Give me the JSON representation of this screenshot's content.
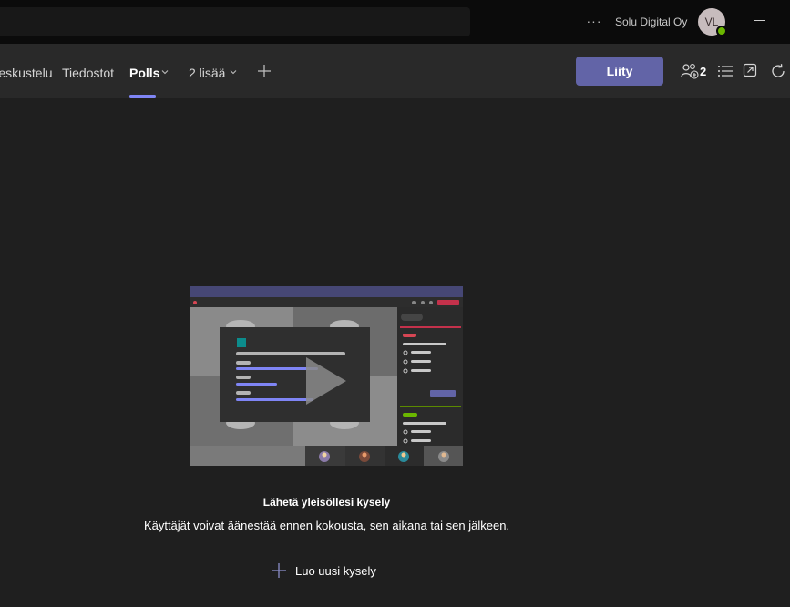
{
  "titlebar": {
    "org_name": "Solu Digital Oy",
    "more_glyph": "···",
    "avatar_initials": "VL",
    "presence_color": "#6bb700"
  },
  "tabs": [
    {
      "label": "Keskustelu",
      "active": false
    },
    {
      "label": "Tiedostot",
      "active": false
    },
    {
      "label": "Polls",
      "active": true
    },
    {
      "label": "2 lisää",
      "active": false
    }
  ],
  "toolbar": {
    "join_label": "Liity",
    "participant_count": "2",
    "accent_color": "#6264a7"
  },
  "empty_state": {
    "title": "Lähetä yleisöllesi kysely",
    "description": "Käyttäjät voivat äänestää ennen kokousta, sen aikana tai sen jälkeen.",
    "new_poll_label": "Luo uusi kysely"
  }
}
